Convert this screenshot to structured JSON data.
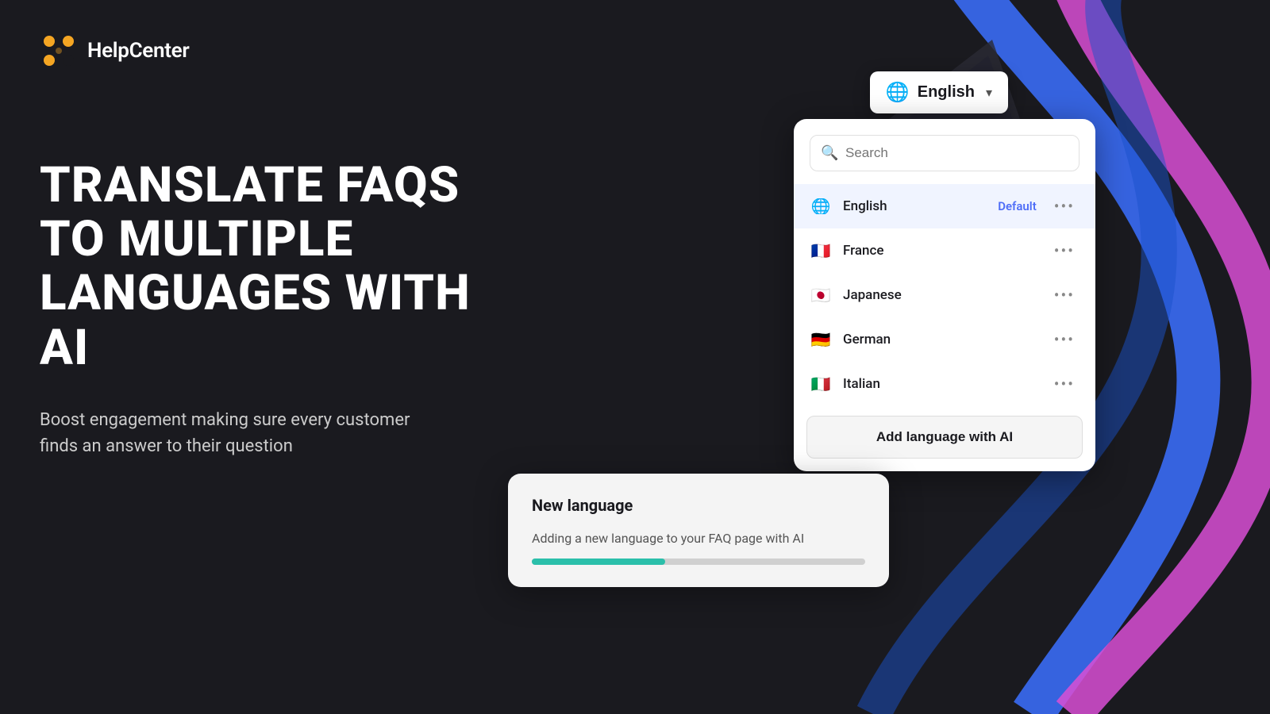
{
  "app": {
    "logo_text": "HelpCenter",
    "logo_icon_color": "#f5a623"
  },
  "language_button": {
    "globe_emoji": "🌐",
    "label": "English",
    "chevron": "▾"
  },
  "hero": {
    "title": "Translate FAQs to multiple languages with AI",
    "subtitle": "Boost engagement making sure every customer finds an answer to their question"
  },
  "language_panel": {
    "search_placeholder": "Search",
    "languages": [
      {
        "name": "English",
        "flag": "🌐",
        "is_default": true,
        "default_label": "Default"
      },
      {
        "name": "France",
        "flag": "🇫🇷",
        "is_default": false,
        "default_label": ""
      },
      {
        "name": "Japanese",
        "flag": "🇯🇵",
        "is_default": false,
        "default_label": ""
      },
      {
        "name": "German",
        "flag": "🇩🇪",
        "is_default": false,
        "default_label": ""
      },
      {
        "name": "Italian",
        "flag": "🇮🇹",
        "is_default": false,
        "default_label": ""
      }
    ],
    "add_button_label": "Add language with AI",
    "more_icon": "•••"
  },
  "new_language_card": {
    "title": "New language",
    "description": "Adding a new language to your FAQ page with AI",
    "progress_percent": 40
  }
}
